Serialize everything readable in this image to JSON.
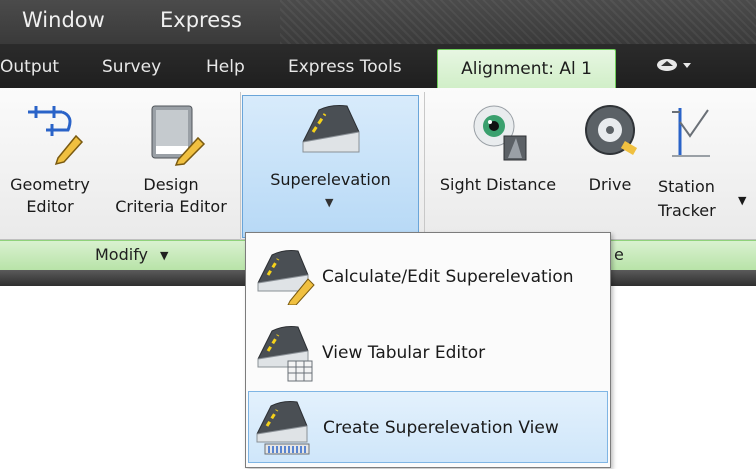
{
  "menubar": {
    "items": [
      "Window",
      "Express"
    ]
  },
  "tabs": {
    "items": [
      "Output",
      "Survey",
      "Help",
      "Express Tools"
    ],
    "active": "Alignment: Al 1",
    "extra": "▾"
  },
  "ribbon": {
    "buttons": {
      "geometry_editor": [
        "Geometry",
        "Editor"
      ],
      "design_criteria": [
        "Design",
        "Criteria Editor"
      ],
      "superelevation": "Superelevation",
      "sight_distance": "Sight Distance",
      "drive": "Drive",
      "station_tracker": [
        "Station",
        "Tracker"
      ]
    },
    "panels": {
      "modify": "Modify",
      "analyze_partial": "e"
    }
  },
  "dropdown": {
    "items": [
      {
        "label": "Calculate/Edit Superelevation"
      },
      {
        "label": "View Tabular Editor"
      },
      {
        "label": "Create Superelevation View"
      }
    ]
  },
  "colors": {
    "ribbon_green": "#cfeec6",
    "selection_blue": "#cfe6fa"
  }
}
